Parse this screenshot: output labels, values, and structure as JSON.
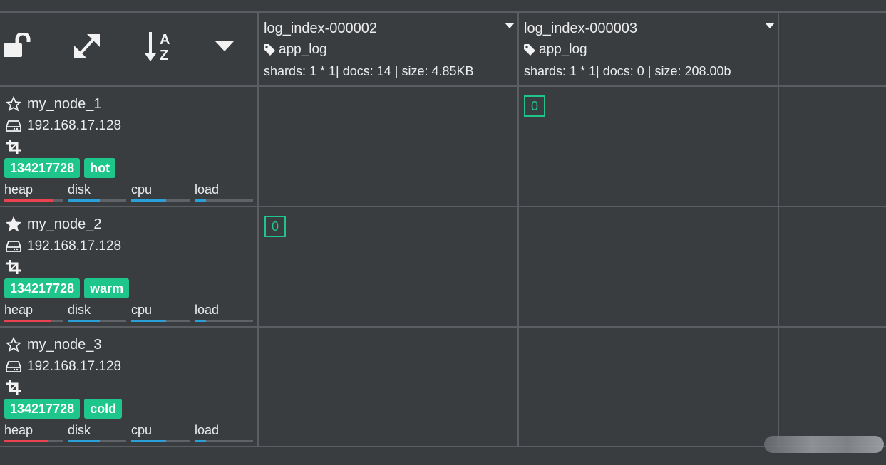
{
  "toolbar": {
    "icons": [
      "unlock-icon",
      "expand-icon",
      "sort-alpha-icon",
      "caret-down-icon"
    ]
  },
  "indices": [
    {
      "name": "log_index-000002",
      "alias": "app_log",
      "stats": "shards: 1 * 1| docs: 14 | size: 4.85KB"
    },
    {
      "name": "log_index-000003",
      "alias": "app_log",
      "stats": "shards: 1 * 1| docs: 0 | size: 208.00b"
    }
  ],
  "nodes": [
    {
      "name": "my_node_1",
      "master": false,
      "ip": "192.168.17.128",
      "id": "134217728",
      "tier": "hot",
      "metrics": {
        "heap_label": "heap",
        "disk_label": "disk",
        "cpu_label": "cpu",
        "load_label": "load"
      },
      "metric_levels": {
        "heap": 0.83,
        "disk": 0.55,
        "cpu": 0.6,
        "load": 0.2
      }
    },
    {
      "name": "my_node_2",
      "master": true,
      "ip": "192.168.17.128",
      "id": "134217728",
      "tier": "warm",
      "metrics": {
        "heap_label": "heap",
        "disk_label": "disk",
        "cpu_label": "cpu",
        "load_label": "load"
      },
      "metric_levels": {
        "heap": 0.8,
        "disk": 0.55,
        "cpu": 0.6,
        "load": 0.2
      }
    },
    {
      "name": "my_node_3",
      "master": false,
      "ip": "192.168.17.128",
      "id": "134217728",
      "tier": "cold",
      "metrics": {
        "heap_label": "heap",
        "disk_label": "disk",
        "cpu_label": "cpu",
        "load_label": "load"
      },
      "metric_levels": {
        "heap": 0.76,
        "disk": 0.55,
        "cpu": 0.6,
        "load": 0.2
      }
    }
  ],
  "shards": [
    {
      "node": "my_node_1",
      "index": "log_index-000003",
      "label": "0"
    },
    {
      "node": "my_node_2",
      "index": "log_index-000002",
      "label": "0"
    }
  ],
  "colors": {
    "background": "#3a3d40",
    "grid_line": "#5a5e62",
    "badge": "#1fc68b",
    "shard_border": "#1fc68b",
    "heap_bar": "#e8434f",
    "disk_bar": "#2a9fd8",
    "cpu_bar": "#2a9fd8",
    "load_bar": "#2a9fd8"
  }
}
